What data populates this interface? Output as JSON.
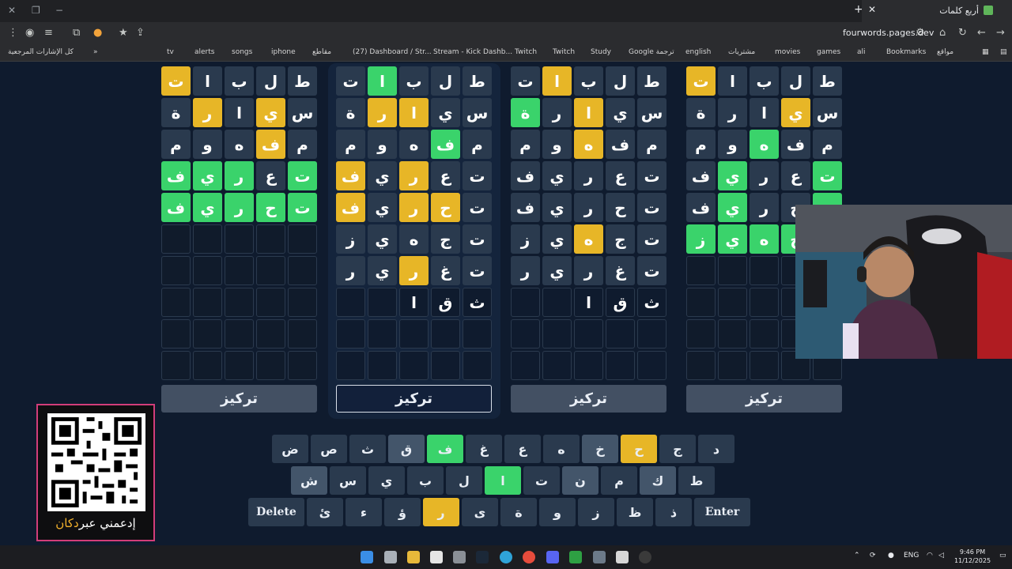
{
  "browser": {
    "tab_title": "أربع كلمات",
    "url": "fourwords.pages.dev",
    "bookmarks": [
      "كل الإشارات المرجعية",
      "tv",
      "alerts",
      "songs",
      "iphone",
      "مقاطع",
      "(27) Dashboard / Str...",
      "Stream - Kick Dashb...",
      "Twitch",
      "Twitch",
      "Study",
      "Google ترجمة",
      "english",
      "مشتريات",
      "movies",
      "games",
      "ali",
      "Bookmarks",
      "مواقع"
    ]
  },
  "boards": [
    {
      "rows": [
        [
          [
            "ط",
            ""
          ],
          [
            "ل",
            ""
          ],
          [
            "ب",
            ""
          ],
          [
            "ا",
            ""
          ],
          [
            "ت",
            "y"
          ]
        ],
        [
          [
            "س",
            ""
          ],
          [
            "ي",
            "y"
          ],
          [
            "ا",
            ""
          ],
          [
            "ر",
            "y"
          ],
          [
            "ة",
            ""
          ]
        ],
        [
          [
            "م",
            ""
          ],
          [
            "ف",
            "y"
          ],
          [
            "ه",
            ""
          ],
          [
            "و",
            ""
          ],
          [
            "م",
            ""
          ]
        ],
        [
          [
            "ت",
            "g"
          ],
          [
            "ع",
            ""
          ],
          [
            "ر",
            "g"
          ],
          [
            "ي",
            "g"
          ],
          [
            "ف",
            "g"
          ]
        ],
        [
          [
            "ت",
            "g"
          ],
          [
            "ح",
            "g"
          ],
          [
            "ر",
            "g"
          ],
          [
            "ي",
            "g"
          ],
          [
            "ف",
            "g"
          ]
        ],
        [
          [
            "",
            "e"
          ],
          [
            "",
            "e"
          ],
          [
            "",
            "e"
          ],
          [
            "",
            "e"
          ],
          [
            "",
            "e"
          ]
        ],
        [
          [
            "",
            "e"
          ],
          [
            "",
            "e"
          ],
          [
            "",
            "e"
          ],
          [
            "",
            "e"
          ],
          [
            "",
            "e"
          ]
        ],
        [
          [
            "",
            "e"
          ],
          [
            "",
            "e"
          ],
          [
            "",
            "e"
          ],
          [
            "",
            "e"
          ],
          [
            "",
            "e"
          ]
        ],
        [
          [
            "",
            "e"
          ],
          [
            "",
            "e"
          ],
          [
            "",
            "e"
          ],
          [
            "",
            "e"
          ],
          [
            "",
            "e"
          ]
        ],
        [
          [
            "",
            "e"
          ],
          [
            "",
            "e"
          ],
          [
            "",
            "e"
          ],
          [
            "",
            "e"
          ],
          [
            "",
            "e"
          ]
        ]
      ]
    },
    {
      "rows": [
        [
          [
            "ط",
            ""
          ],
          [
            "ل",
            ""
          ],
          [
            "ب",
            ""
          ],
          [
            "ا",
            "g"
          ],
          [
            "ت",
            ""
          ]
        ],
        [
          [
            "س",
            ""
          ],
          [
            "ي",
            ""
          ],
          [
            "ا",
            "y"
          ],
          [
            "ر",
            "y"
          ],
          [
            "ة",
            ""
          ]
        ],
        [
          [
            "م",
            ""
          ],
          [
            "ف",
            "g"
          ],
          [
            "ه",
            ""
          ],
          [
            "و",
            ""
          ],
          [
            "م",
            ""
          ]
        ],
        [
          [
            "ت",
            ""
          ],
          [
            "ع",
            ""
          ],
          [
            "ر",
            "y"
          ],
          [
            "ي",
            ""
          ],
          [
            "ف",
            "y"
          ]
        ],
        [
          [
            "ت",
            ""
          ],
          [
            "ح",
            "y"
          ],
          [
            "ر",
            "y"
          ],
          [
            "ي",
            ""
          ],
          [
            "ف",
            "y"
          ]
        ],
        [
          [
            "ت",
            ""
          ],
          [
            "ج",
            ""
          ],
          [
            "ه",
            ""
          ],
          [
            "ي",
            ""
          ],
          [
            "ز",
            ""
          ]
        ],
        [
          [
            "ت",
            ""
          ],
          [
            "غ",
            ""
          ],
          [
            "ر",
            "y"
          ],
          [
            "ي",
            ""
          ],
          [
            "ر",
            ""
          ]
        ],
        [
          [
            "ث",
            "b"
          ],
          [
            "ق",
            "b"
          ],
          [
            "ا",
            "b"
          ],
          [
            "",
            "b"
          ],
          [
            "",
            "b"
          ]
        ],
        [
          [
            "",
            "b"
          ],
          [
            "",
            "b"
          ],
          [
            "",
            "b"
          ],
          [
            "",
            "b"
          ],
          [
            "",
            "b"
          ]
        ],
        [
          [
            "",
            "b"
          ],
          [
            "",
            "b"
          ],
          [
            "",
            "b"
          ],
          [
            "",
            "b"
          ],
          [
            "",
            "b"
          ]
        ]
      ]
    },
    {
      "rows": [
        [
          [
            "ط",
            ""
          ],
          [
            "ل",
            ""
          ],
          [
            "ب",
            ""
          ],
          [
            "ا",
            "y"
          ],
          [
            "ت",
            ""
          ]
        ],
        [
          [
            "س",
            ""
          ],
          [
            "ي",
            ""
          ],
          [
            "ا",
            "y"
          ],
          [
            "ر",
            ""
          ],
          [
            "ة",
            "g"
          ]
        ],
        [
          [
            "م",
            ""
          ],
          [
            "ف",
            ""
          ],
          [
            "ه",
            "y"
          ],
          [
            "و",
            ""
          ],
          [
            "م",
            ""
          ]
        ],
        [
          [
            "ت",
            ""
          ],
          [
            "ع",
            ""
          ],
          [
            "ر",
            ""
          ],
          [
            "ي",
            ""
          ],
          [
            "ف",
            ""
          ]
        ],
        [
          [
            "ت",
            ""
          ],
          [
            "ح",
            ""
          ],
          [
            "ر",
            ""
          ],
          [
            "ي",
            ""
          ],
          [
            "ف",
            ""
          ]
        ],
        [
          [
            "ت",
            ""
          ],
          [
            "ج",
            ""
          ],
          [
            "ه",
            "y"
          ],
          [
            "ي",
            ""
          ],
          [
            "ز",
            ""
          ]
        ],
        [
          [
            "ت",
            ""
          ],
          [
            "غ",
            ""
          ],
          [
            "ر",
            ""
          ],
          [
            "ي",
            ""
          ],
          [
            "ر",
            ""
          ]
        ],
        [
          [
            "ث",
            "b"
          ],
          [
            "ق",
            "b"
          ],
          [
            "ا",
            "b"
          ],
          [
            "",
            "b"
          ],
          [
            "",
            "b"
          ]
        ],
        [
          [
            "",
            "b"
          ],
          [
            "",
            "b"
          ],
          [
            "",
            "b"
          ],
          [
            "",
            "b"
          ],
          [
            "",
            "b"
          ]
        ],
        [
          [
            "",
            "b"
          ],
          [
            "",
            "b"
          ],
          [
            "",
            "b"
          ],
          [
            "",
            "b"
          ],
          [
            "",
            "b"
          ]
        ]
      ]
    },
    {
      "rows": [
        [
          [
            "ط",
            ""
          ],
          [
            "ل",
            ""
          ],
          [
            "ب",
            ""
          ],
          [
            "ا",
            ""
          ],
          [
            "ت",
            "y"
          ]
        ],
        [
          [
            "س",
            ""
          ],
          [
            "ي",
            "y"
          ],
          [
            "ا",
            ""
          ],
          [
            "ر",
            ""
          ],
          [
            "ة",
            ""
          ]
        ],
        [
          [
            "م",
            ""
          ],
          [
            "ف",
            ""
          ],
          [
            "ه",
            "g"
          ],
          [
            "و",
            ""
          ],
          [
            "م",
            ""
          ]
        ],
        [
          [
            "ت",
            "g"
          ],
          [
            "ع",
            ""
          ],
          [
            "ر",
            ""
          ],
          [
            "ي",
            "g"
          ],
          [
            "ف",
            ""
          ]
        ],
        [
          [
            "ت",
            "g"
          ],
          [
            "ح",
            ""
          ],
          [
            "ر",
            ""
          ],
          [
            "ي",
            "g"
          ],
          [
            "ف",
            ""
          ]
        ],
        [
          [
            "ت",
            "g"
          ],
          [
            "ج",
            "g"
          ],
          [
            "ه",
            "g"
          ],
          [
            "ي",
            "g"
          ],
          [
            "ز",
            "g"
          ]
        ],
        [
          [
            "",
            "e"
          ],
          [
            "",
            "e"
          ],
          [
            "",
            "e"
          ],
          [
            "",
            "e"
          ],
          [
            "",
            "e"
          ]
        ],
        [
          [
            "",
            "e"
          ],
          [
            "",
            "e"
          ],
          [
            "",
            "e"
          ],
          [
            "",
            "e"
          ],
          [
            "",
            "e"
          ]
        ],
        [
          [
            "",
            "e"
          ],
          [
            "",
            "e"
          ],
          [
            "",
            "e"
          ],
          [
            "",
            "e"
          ],
          [
            "",
            "e"
          ]
        ],
        [
          [
            "",
            "e"
          ],
          [
            "",
            "e"
          ],
          [
            "",
            "e"
          ],
          [
            "",
            "e"
          ],
          [
            "",
            "e"
          ]
        ]
      ]
    }
  ],
  "focus_label": "تركيز",
  "keyboard": {
    "row1": [
      [
        "د",
        ""
      ],
      [
        "ج",
        ""
      ],
      [
        "ح",
        "y"
      ],
      [
        "خ",
        "light"
      ],
      [
        "ه",
        ""
      ],
      [
        "ع",
        ""
      ],
      [
        "غ",
        ""
      ],
      [
        "ف",
        "g"
      ],
      [
        "ق",
        "light"
      ],
      [
        "ث",
        ""
      ],
      [
        "ص",
        ""
      ],
      [
        "ض",
        ""
      ]
    ],
    "row2": [
      [
        "ط",
        ""
      ],
      [
        "ك",
        "light"
      ],
      [
        "م",
        ""
      ],
      [
        "ن",
        "light"
      ],
      [
        "ت",
        ""
      ],
      [
        "ا",
        "g"
      ],
      [
        "ل",
        ""
      ],
      [
        "ب",
        ""
      ],
      [
        "ي",
        ""
      ],
      [
        "س",
        ""
      ],
      [
        "ش",
        "light"
      ]
    ],
    "row3": [
      [
        "ذ",
        ""
      ],
      [
        "ظ",
        ""
      ],
      [
        "ز",
        ""
      ],
      [
        "و",
        ""
      ],
      [
        "ة",
        ""
      ],
      [
        "ى",
        ""
      ],
      [
        "ر",
        "y"
      ],
      [
        "ؤ",
        ""
      ],
      [
        "ء",
        ""
      ],
      [
        "ئ",
        ""
      ]
    ],
    "enter": "Enter",
    "delete": "Delete"
  },
  "qr_card": {
    "caption_pre": "إدعمني عبر",
    "caption_accent": "دكان"
  },
  "taskbar": {
    "lang": "ENG",
    "time": "9:46 PM",
    "date": "11/12/2025"
  }
}
